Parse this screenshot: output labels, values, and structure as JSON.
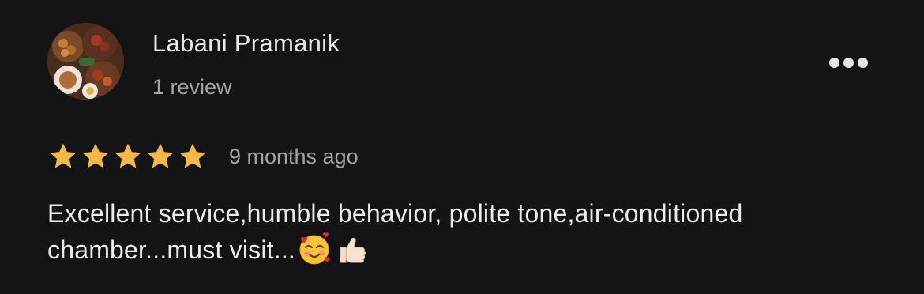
{
  "review": {
    "author_name": "Labani Pramanik",
    "author_review_count": "1 review",
    "rating": 5,
    "rating_max": 5,
    "time_ago": "9 months ago",
    "text": "Excellent service,humble behavior, polite tone,air-conditioned chamber...must visit...",
    "emojis": [
      "smiling-face-with-hearts-icon",
      "thumbs-up-icon"
    ],
    "more_menu_icon": "more-horizontal-icon"
  },
  "colors": {
    "background": "#141316",
    "star": "#f3b84a",
    "primary_text": "#ecebee",
    "secondary_text": "#a3a1a8"
  }
}
